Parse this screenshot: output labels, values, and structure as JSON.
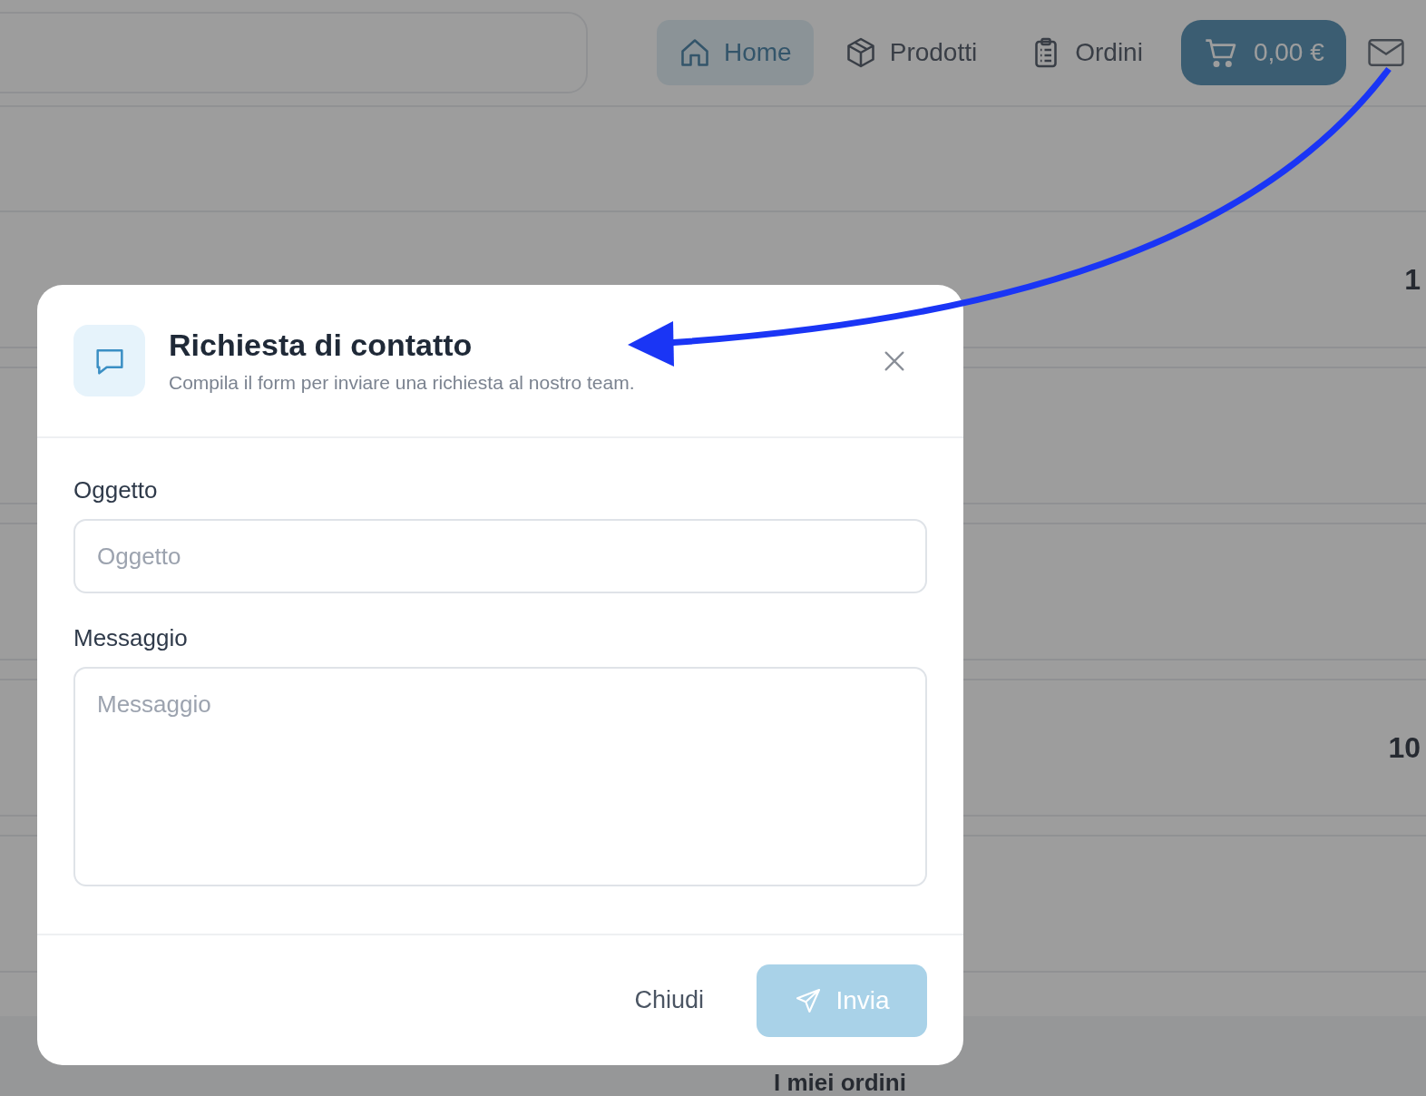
{
  "header": {
    "nav": [
      {
        "label": "Home",
        "selected": true
      },
      {
        "label": "Prodotti",
        "selected": false
      },
      {
        "label": "Ordini",
        "selected": false
      }
    ],
    "cart": {
      "total": "0,00 €"
    }
  },
  "background_rows": [
    {
      "value": "1"
    },
    {},
    {},
    {
      "value": "10"
    },
    {}
  ],
  "background_footer": {
    "title": "I miei ordini"
  },
  "dialog": {
    "title": "Richiesta di contatto",
    "subtitle": "Compila il form per inviare una richiesta al nostro team.",
    "fields": [
      {
        "kind": "input",
        "label": "Oggetto",
        "placeholder": "Oggetto"
      },
      {
        "kind": "textarea",
        "label": "Messaggio",
        "placeholder": "Messaggio"
      }
    ],
    "buttons": [
      {
        "kind": "secondary",
        "label": "Chiudi",
        "disabled": false
      },
      {
        "kind": "primary",
        "label": "Invia",
        "disabled": true
      }
    ]
  }
}
